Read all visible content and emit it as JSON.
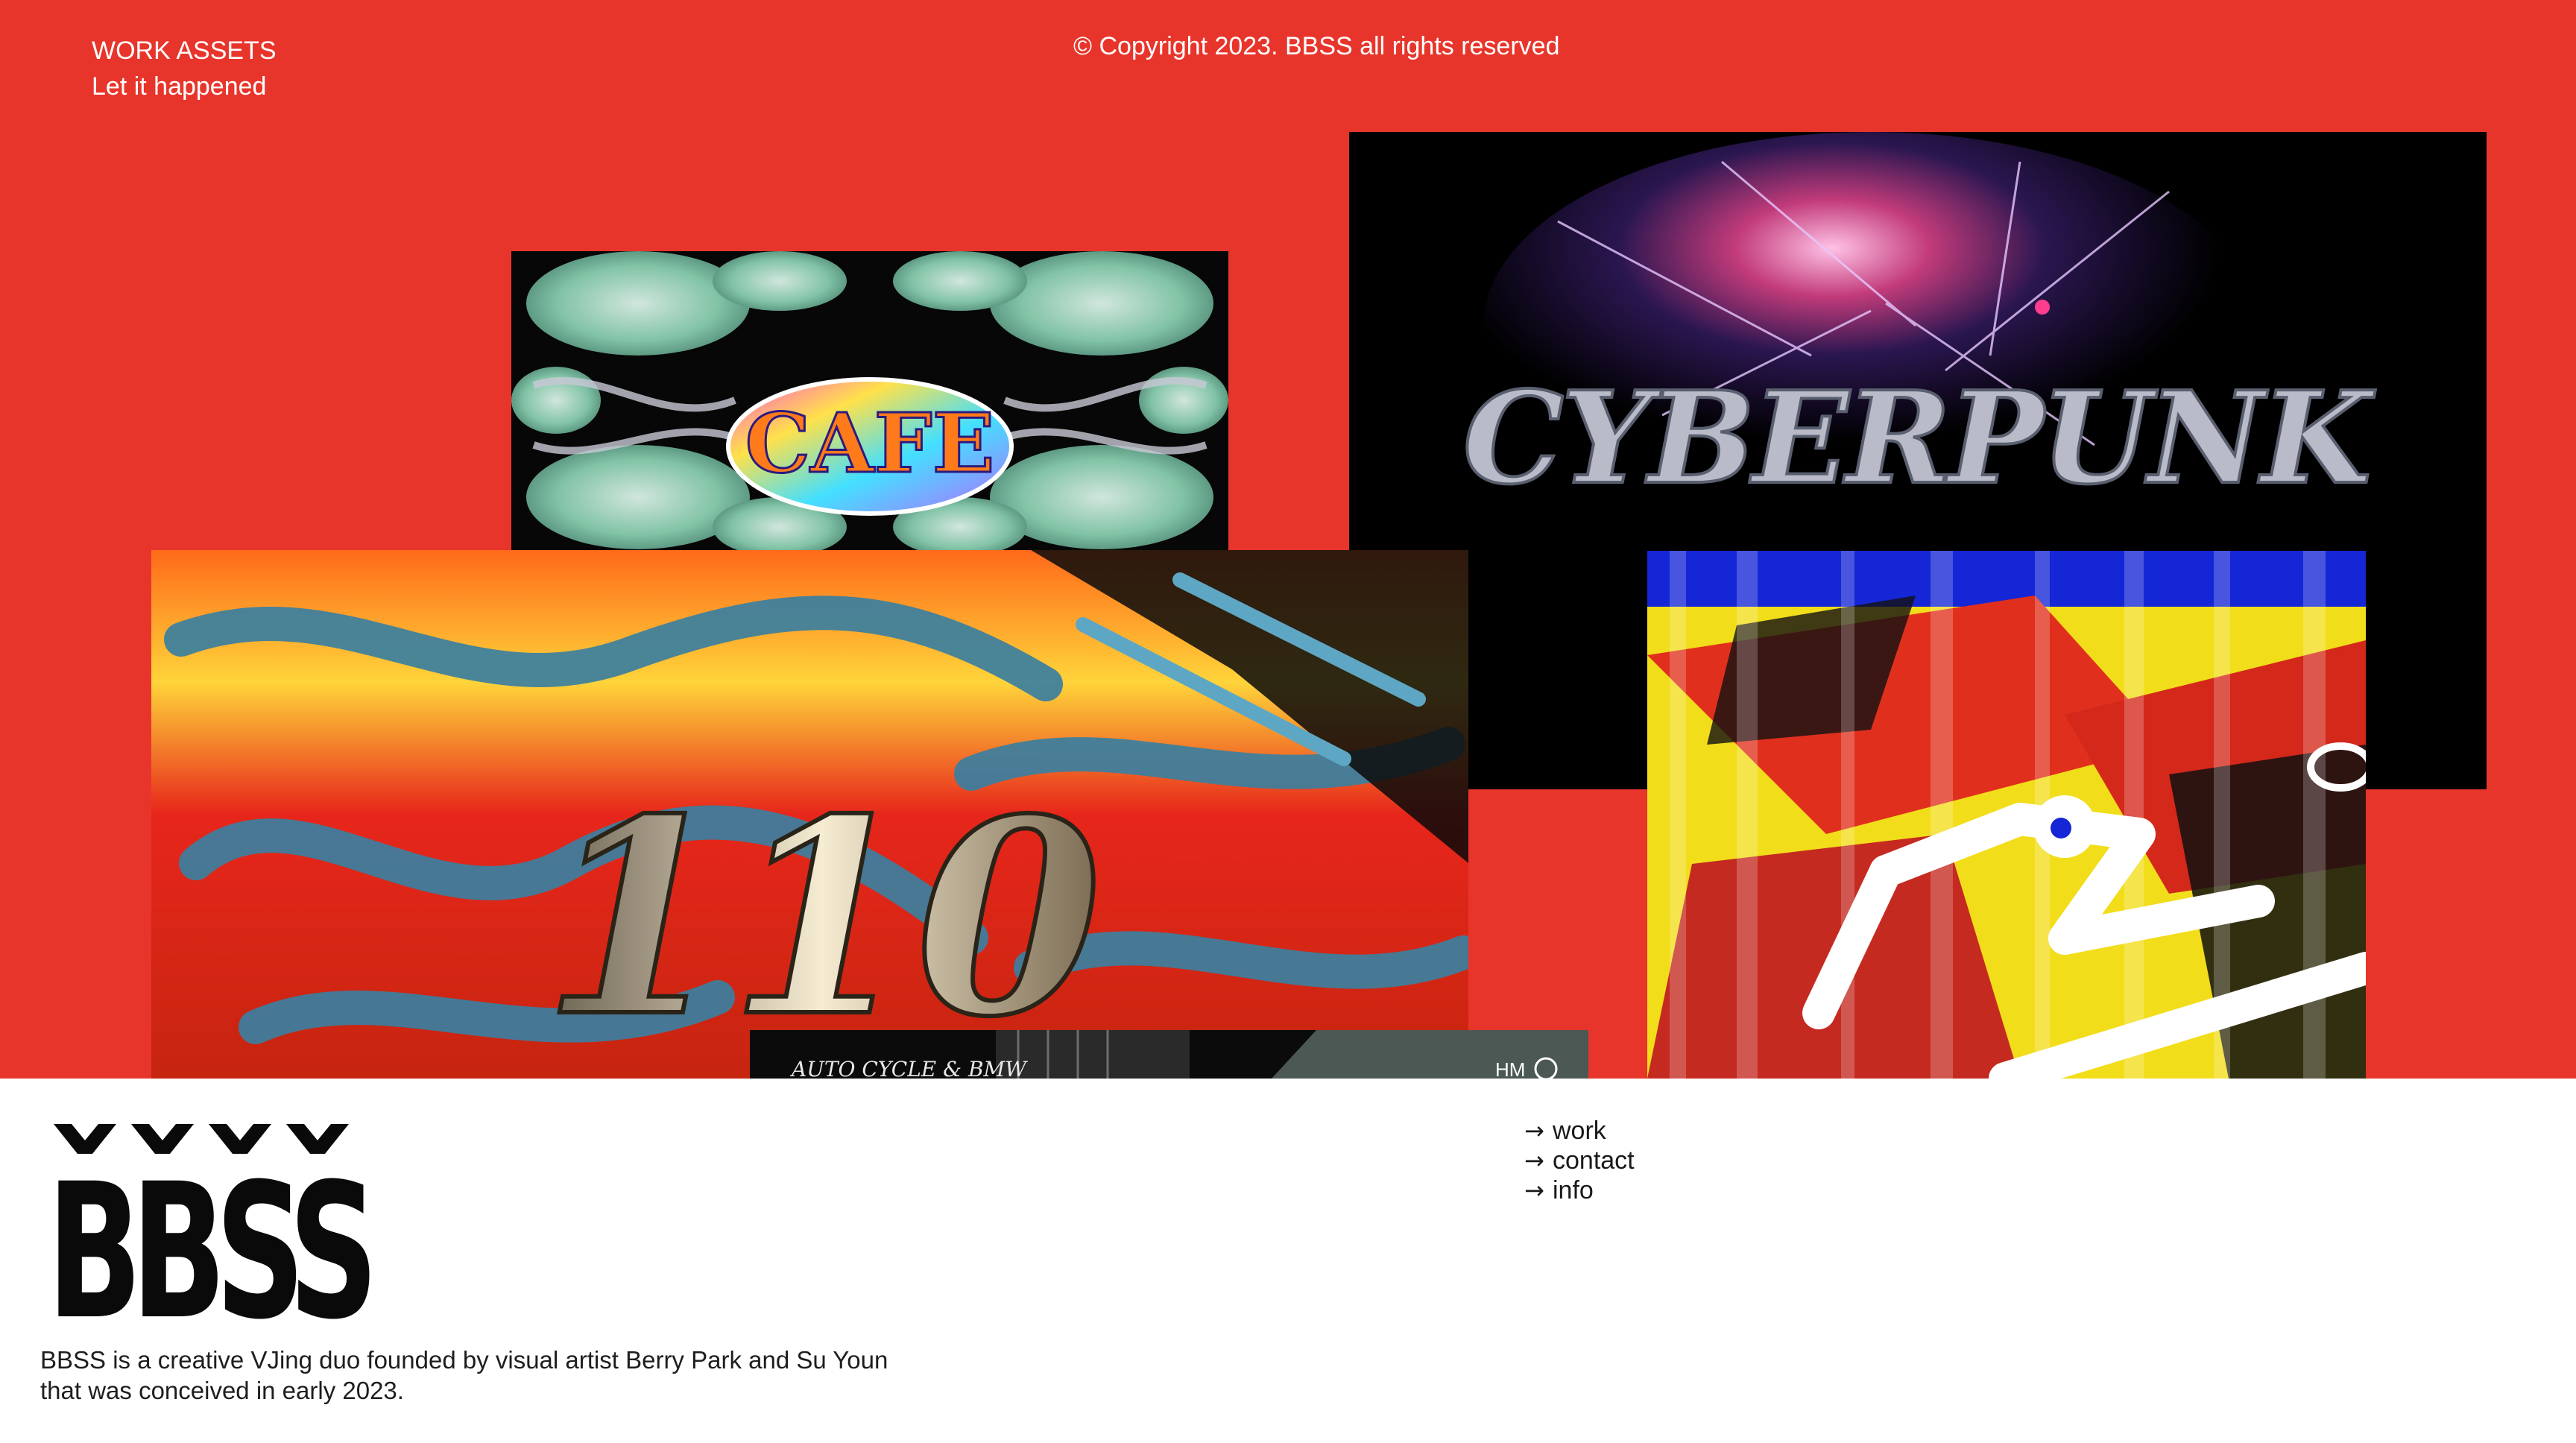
{
  "header": {
    "title": "WORK ASSETS",
    "subtitle": "Let it happened",
    "copyright": "© Copyright 2023. BBSS  all rights reserved"
  },
  "tiles": {
    "cafe": "CAFE",
    "cyber": "CYBERPUNK",
    "number": "110",
    "auto_caption": "AUTO CYCLE & BMW",
    "auto_mark": "HM"
  },
  "footer": {
    "logo_text": "BBSS",
    "about": "BBSS is a creative VJing duo founded by visual artist Berry Park and Su Youn that was conceived in early 2023.",
    "nav": [
      {
        "label": "work",
        "icon": "arrow-right-icon"
      },
      {
        "label": "contact",
        "icon": "arrow-right-icon"
      },
      {
        "label": "info",
        "icon": "arrow-right-icon"
      }
    ]
  },
  "colors": {
    "background": "#e8352b",
    "footer": "#ffffff",
    "text_light": "#ffffff",
    "text_dark": "#1a1a1a"
  }
}
